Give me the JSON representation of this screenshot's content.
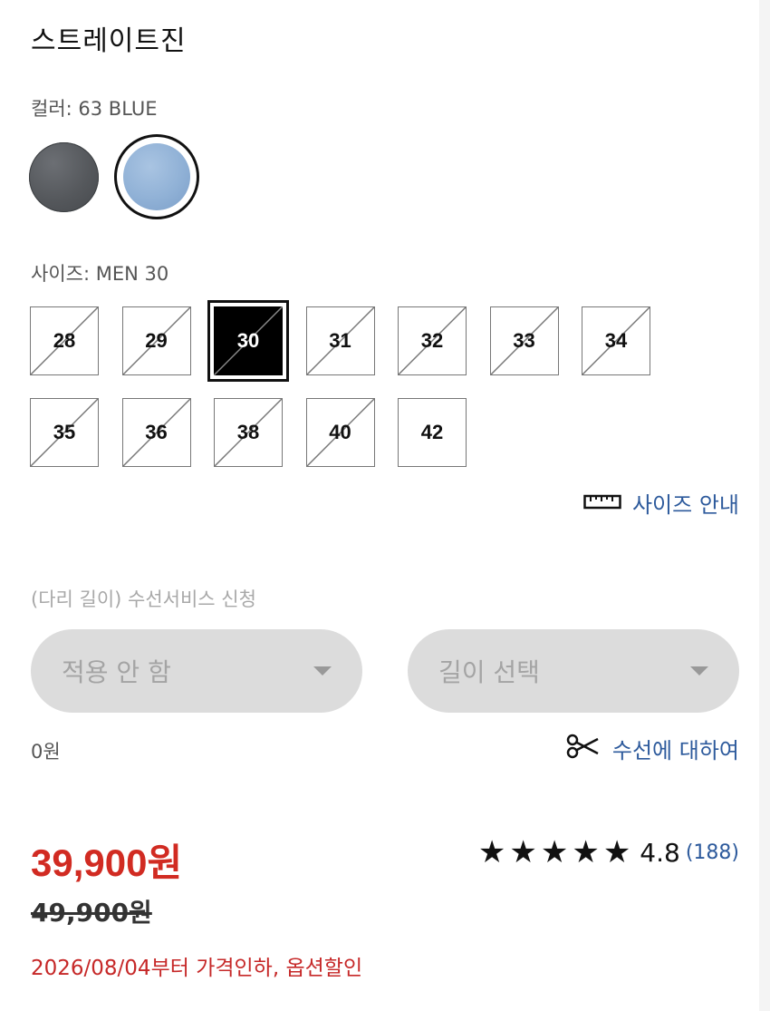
{
  "product": {
    "name": "스트레이트진"
  },
  "color": {
    "label": "컬러: 63 BLUE",
    "swatches": [
      {
        "name": "dark-gray",
        "color": "#5a5d61",
        "selected": false
      },
      {
        "name": "light-blue",
        "color": "#95b4d8",
        "selected": true
      }
    ]
  },
  "size": {
    "label": "사이즈: MEN 30",
    "options": [
      {
        "value": "28",
        "available": false,
        "selected": false
      },
      {
        "value": "29",
        "available": false,
        "selected": false
      },
      {
        "value": "30",
        "available": false,
        "selected": true
      },
      {
        "value": "31",
        "available": false,
        "selected": false
      },
      {
        "value": "32",
        "available": false,
        "selected": false
      },
      {
        "value": "33",
        "available": false,
        "selected": false
      },
      {
        "value": "34",
        "available": false,
        "selected": false
      },
      {
        "value": "35",
        "available": false,
        "selected": false
      },
      {
        "value": "36",
        "available": false,
        "selected": false
      },
      {
        "value": "38",
        "available": false,
        "selected": false
      },
      {
        "value": "40",
        "available": false,
        "selected": false
      },
      {
        "value": "42",
        "available": true,
        "selected": false
      }
    ],
    "guide_label": "사이즈 안내",
    "guide_icon": "ruler-icon"
  },
  "hemming": {
    "label": "(다리 길이) 수선서비스 신청",
    "apply_placeholder": "적용 안 함",
    "length_placeholder": "길이 선택",
    "price": "0원",
    "about_label": "수선에 대하여",
    "about_icon": "scissors-icon"
  },
  "pricing": {
    "sale_price": "39,900원",
    "original_price": "49,900원",
    "promo": "2026/08/04부터 가격인하,  옵션할인",
    "sale_color": "#d12b22"
  },
  "rating": {
    "stars": "★★★★★",
    "score": "4.8",
    "count": "(188)"
  },
  "link_color": "#2d5a9c"
}
